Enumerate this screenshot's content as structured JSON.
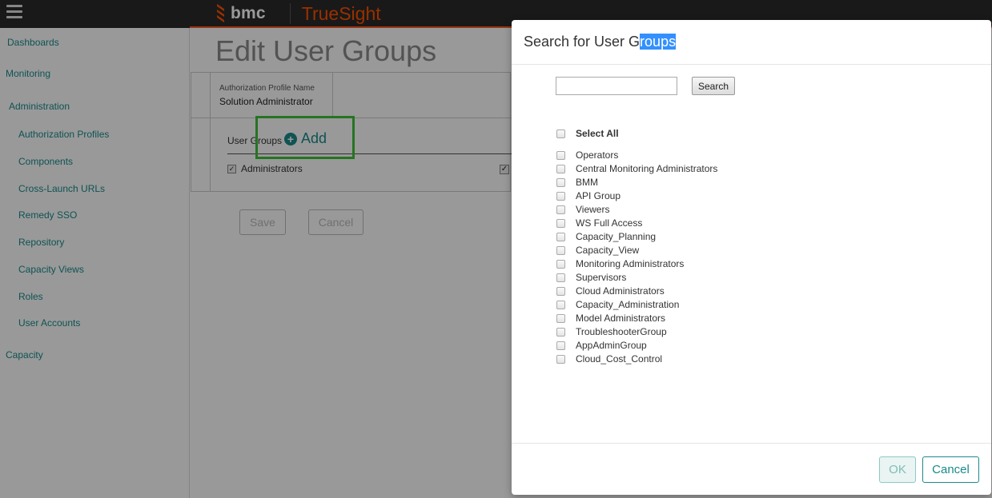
{
  "header": {
    "brand": "bmc",
    "product": "TrueSight"
  },
  "sidebar": {
    "items": [
      {
        "label": "Dashboards"
      },
      {
        "label": "Monitoring"
      },
      {
        "label": "Administration"
      },
      {
        "label": "Authorization Profiles"
      },
      {
        "label": "Components"
      },
      {
        "label": "Cross-Launch URLs"
      },
      {
        "label": "Remedy SSO"
      },
      {
        "label": "Repository"
      },
      {
        "label": "Capacity Views"
      },
      {
        "label": "Roles"
      },
      {
        "label": "User Accounts"
      },
      {
        "label": "Capacity"
      }
    ]
  },
  "page": {
    "title": "Edit User Groups",
    "profile_field_label": "Authorization Profile Name",
    "profile_field_value": "Solution Administrator",
    "user_groups_label": "User Groups",
    "add_label": "Add",
    "member": "Administrators",
    "save_label": "Save",
    "cancel_label": "Cancel"
  },
  "modal": {
    "title_prefix": "Search for User G",
    "title_selected": "roups",
    "search_placeholder": "",
    "search_button": "Search",
    "select_all": "Select All",
    "groups": [
      "Operators",
      "Central Monitoring Administrators",
      "BMM",
      "API Group",
      "Viewers",
      "WS Full Access",
      "Capacity_Planning",
      "Capacity_View",
      "Monitoring Administrators",
      "Supervisors",
      "Cloud Administrators",
      "Capacity_Administration",
      "Model Administrators",
      "TroubleshooterGroup",
      "AppAdminGroup",
      "Cloud_Cost_Control"
    ],
    "ok_label": "OK",
    "cancel_label": "Cancel"
  },
  "colors": {
    "accent": "#1b8a8a",
    "brand_orange": "#fe5000",
    "highlight": "#3fc23a",
    "topbar": "#2b2b2b"
  }
}
